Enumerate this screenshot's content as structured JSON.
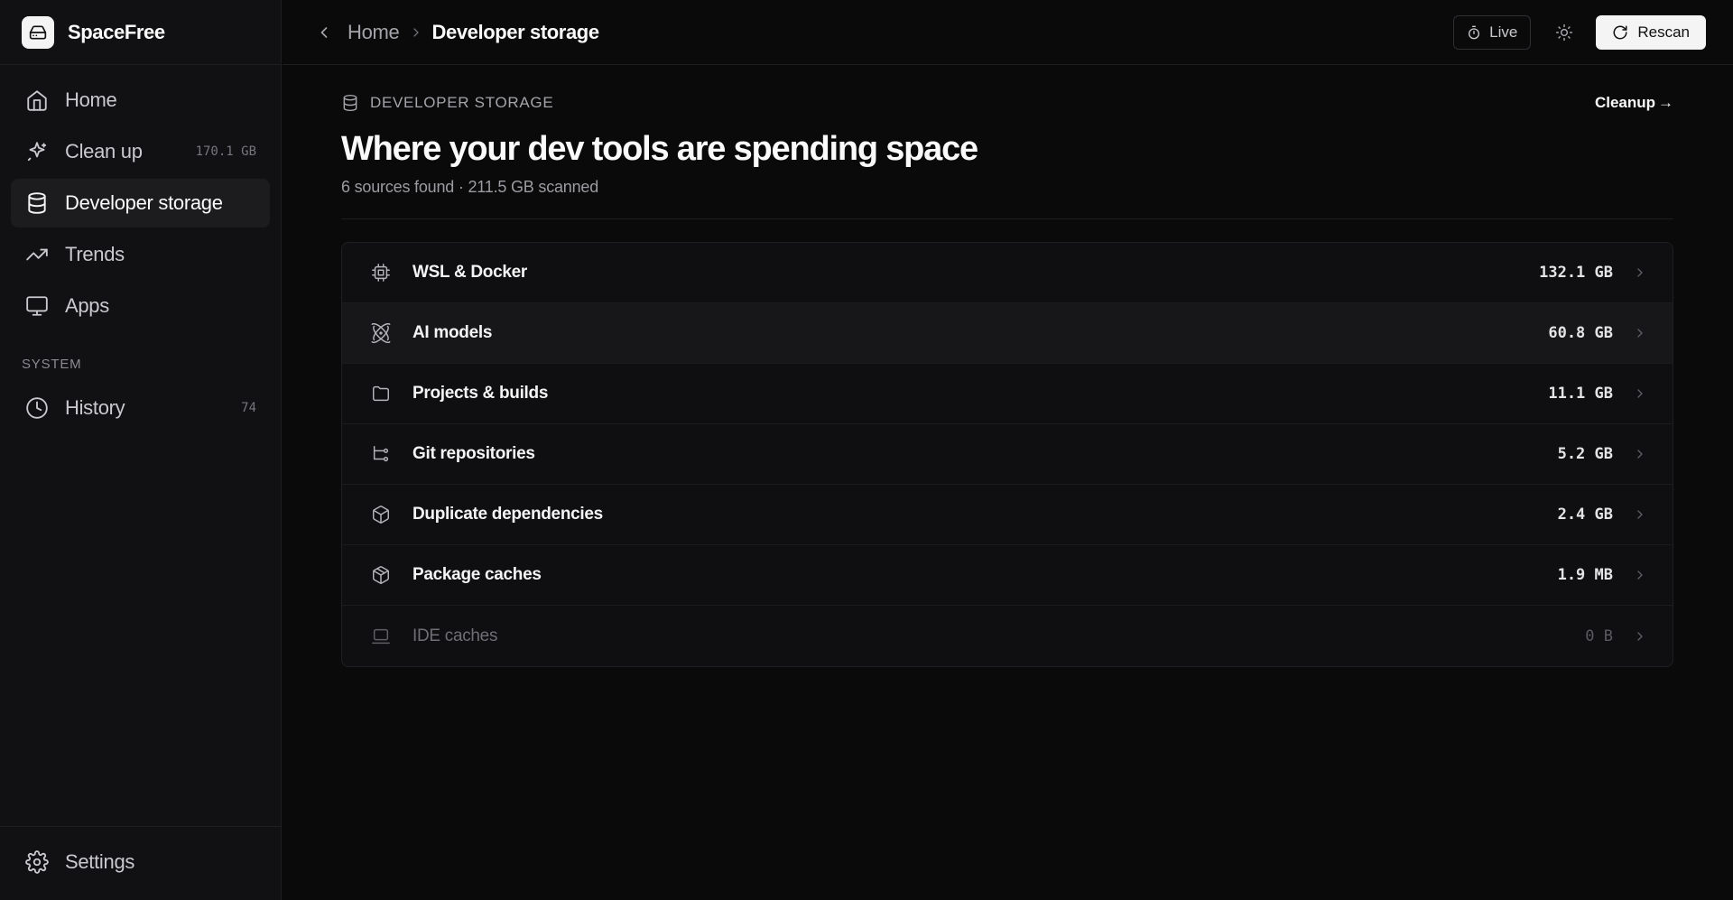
{
  "app": {
    "name": "SpaceFree"
  },
  "sidebar": {
    "items": [
      {
        "label": "Home",
        "icon": "home-icon"
      },
      {
        "label": "Clean up",
        "icon": "sparkle-icon",
        "count": "170.1 GB"
      },
      {
        "label": "Developer storage",
        "icon": "database-icon",
        "active": true
      },
      {
        "label": "Trends",
        "icon": "trend-icon"
      },
      {
        "label": "Apps",
        "icon": "monitor-icon"
      }
    ],
    "section_label": "SYSTEM",
    "system_items": [
      {
        "label": "History",
        "icon": "clock-icon",
        "count": "74"
      }
    ],
    "settings_label": "Settings"
  },
  "topbar": {
    "breadcrumb_home": "Home",
    "breadcrumb_current": "Developer storage",
    "live_label": "Live",
    "rescan_label": "Rescan"
  },
  "main": {
    "eyebrow": "DEVELOPER STORAGE",
    "cleanup_label": "Cleanup",
    "cleanup_arrow": "→",
    "title": "Where your dev tools are spending space",
    "subtitle": "6 sources found · 211.5 GB scanned",
    "rows": [
      {
        "name": "WSL & Docker",
        "size": "132.1 GB",
        "icon": "cpu-icon"
      },
      {
        "name": "AI models",
        "size": "60.8 GB",
        "icon": "atom-icon"
      },
      {
        "name": "Projects & builds",
        "size": "11.1 GB",
        "icon": "folder-icon"
      },
      {
        "name": "Git repositories",
        "size": "5.2 GB",
        "icon": "git-branch-icon"
      },
      {
        "name": "Duplicate dependencies",
        "size": "2.4 GB",
        "icon": "package-icon"
      },
      {
        "name": "Package caches",
        "size": "1.9 MB",
        "icon": "box-icon"
      },
      {
        "name": "IDE caches",
        "size": "0 B",
        "icon": "laptop-icon"
      }
    ]
  },
  "colors": {
    "background": "#0a0a0b",
    "sidebar": "#111113",
    "accent_button": "#f4f4f5"
  }
}
